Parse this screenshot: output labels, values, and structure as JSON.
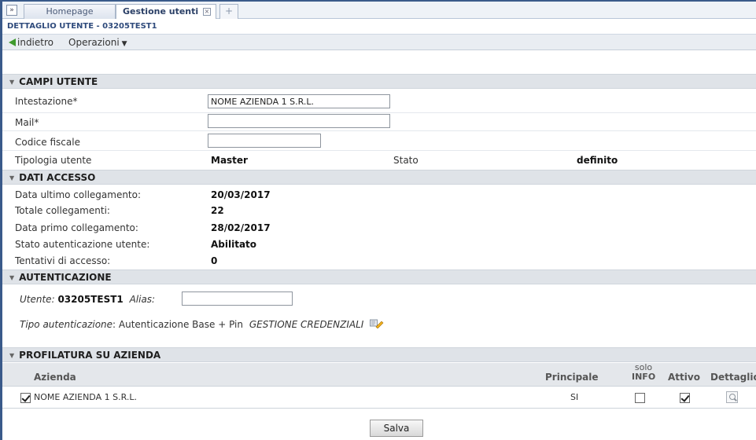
{
  "tabs": {
    "toggle": "»",
    "home": "Homepage",
    "gestione": "Gestione utenti",
    "close": "×",
    "new_tab": "+"
  },
  "detail": {
    "title": "DETTAGLIO UTENTE - 03205TEST1"
  },
  "toolbar": {
    "back": "indietro",
    "operations": "Operazioni",
    "operations_caret": "▼"
  },
  "campi_utente": {
    "header": "CAMPI UTENTE",
    "intestazione_label": "Intestazione*",
    "intestazione_value": "NOME AZIENDA 1 S.R.L.",
    "mail_label": "Mail*",
    "mail_value": "",
    "codice_label": "Codice fiscale",
    "codice_value": "",
    "tipologia_label": "Tipologia utente",
    "tipologia_value": "Master",
    "stato_label": "Stato",
    "stato_value": "definito"
  },
  "dati_accesso": {
    "header": "DATI ACCESSO",
    "rows": [
      {
        "label": "Data ultimo collegamento:",
        "value": "20/03/2017"
      },
      {
        "label": "Totale collegamenti:",
        "value": "22"
      },
      {
        "label": "Data primo collegamento:",
        "value": "28/02/2017"
      },
      {
        "label": "Stato autenticazione utente:",
        "value": "Abilitato"
      },
      {
        "label": "Tentativi di accesso:",
        "value": "0"
      }
    ]
  },
  "autenticazione": {
    "header": "AUTENTICAZIONE",
    "utente_label": "Utente:",
    "utente_value": "03205TEST1",
    "alias_label": "Alias:",
    "alias_value": "",
    "tipo_label": "Tipo autenticazione",
    "tipo_value": ": Autenticazione Base + Pin",
    "credenziali_link": "GESTIONE CREDENZIALI"
  },
  "profilatura": {
    "header": "PROFILATURA SU AZIENDA",
    "columns": {
      "azienda": "Azienda",
      "principale": "Principale",
      "solo_line1": "solo",
      "solo_line2": "INFO",
      "attivo": "Attivo",
      "dettaglio": "Dettaglio"
    },
    "rows": [
      {
        "azienda": "NOME AZIENDA 1 S.R.L.",
        "principale": "SI",
        "selected": true,
        "solo_info": false,
        "attivo": true
      }
    ]
  },
  "actions": {
    "save": "Salva"
  },
  "colors": {
    "frame": "#3a5a8a",
    "section_bg": "#dfe3e8",
    "back_arrow": "#3f9a2e",
    "title_text": "#2f4b7c"
  }
}
